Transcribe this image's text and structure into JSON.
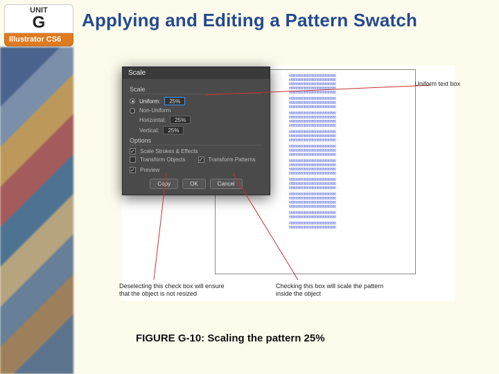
{
  "unit_badge": {
    "unit_word": "UNIT",
    "unit_letter": "G",
    "product": "Illustrator CS6"
  },
  "slide": {
    "title": "Applying and Editing a Pattern Swatch",
    "figure_caption": "FIGURE G-10: Scaling the pattern 25%"
  },
  "dialog": {
    "title": "Scale",
    "scale_group": "Scale",
    "options_group": "Options",
    "uniform_label": "Uniform:",
    "uniform_value": "25%",
    "nonuniform_label": "Non-Uniform",
    "horizontal_label": "Horizontal:",
    "horizontal_value": "25%",
    "vertical_label": "Vertical:",
    "vertical_value": "25%",
    "scale_strokes_label": "Scale Strokes & Effects",
    "transform_objects_label": "Transform Objects",
    "transform_patterns_label": "Transform Patterns",
    "preview_label": "Preview",
    "copy_btn": "Copy",
    "ok_btn": "OK",
    "cancel_btn": "Cancel",
    "checks": {
      "scale_strokes": "✓",
      "transform_objects": "",
      "transform_patterns": "✓",
      "preview": "✓"
    }
  },
  "annotations": {
    "uniform": "Uniform text box",
    "deselect": "Deselecting this check box will ensure that the object is not resized",
    "pattern_scale": "Checking this box will scale the pattern inside the object"
  },
  "pattern": {
    "row": "BBBBBBBBBBBBBBBBBBBBBBBBB"
  }
}
